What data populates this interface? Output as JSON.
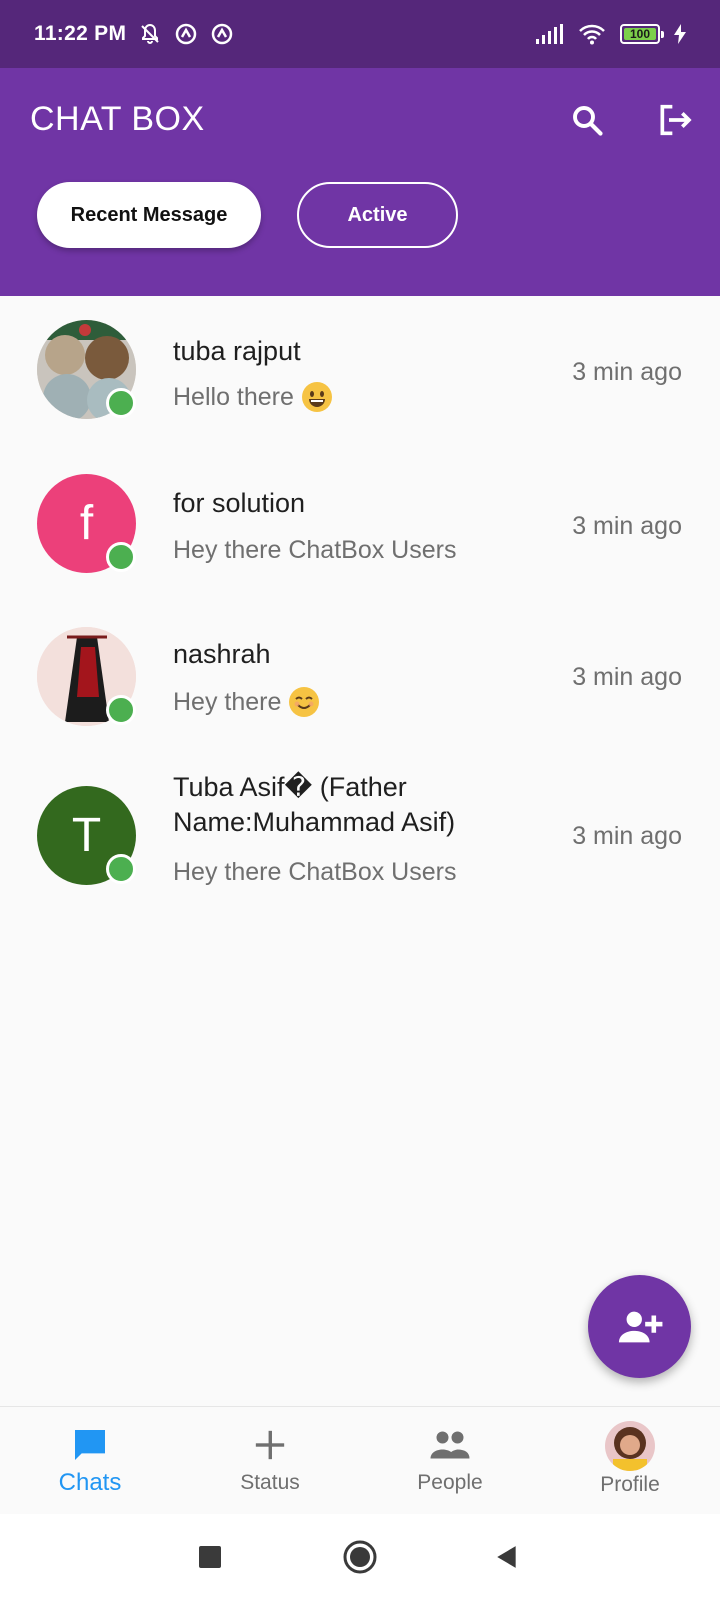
{
  "status_bar": {
    "time": "11:22 PM",
    "battery": "100"
  },
  "header": {
    "title": "CHAT BOX",
    "tabs": [
      {
        "label": "Recent Message",
        "selected": true
      },
      {
        "label": "Active",
        "selected": false
      }
    ]
  },
  "chats": [
    {
      "name": "tuba rajput",
      "message": "Hello there",
      "emoji": "grinning",
      "time": "3 min ago",
      "online": true
    },
    {
      "name": "for solution",
      "message": "Hey there ChatBox Users",
      "time": "3 min ago",
      "online": true,
      "avatar_letter": "f",
      "avatar_color": "#ec407a"
    },
    {
      "name": "nashrah",
      "message": "Hey there",
      "emoji": "smiling",
      "time": "3 min ago",
      "online": true
    },
    {
      "name": "Tuba Asif� (Father Name:Muhammad Asif)",
      "message": "Hey there ChatBox Users",
      "time": "3 min ago",
      "online": true,
      "avatar_letter": "T",
      "avatar_color": "#33691e"
    }
  ],
  "bottom_nav": {
    "items": [
      {
        "label": "Chats",
        "icon": "chat-bubble-icon",
        "active": true
      },
      {
        "label": "Status",
        "icon": "plus-icon",
        "active": false
      },
      {
        "label": "People",
        "icon": "people-icon",
        "active": false
      },
      {
        "label": "Profile",
        "icon": "profile-avatar",
        "active": false
      }
    ]
  },
  "colors": {
    "status_bar": "#55277a",
    "header": "#7035a5",
    "online": "#4caf50",
    "active_nav": "#2196f3"
  }
}
